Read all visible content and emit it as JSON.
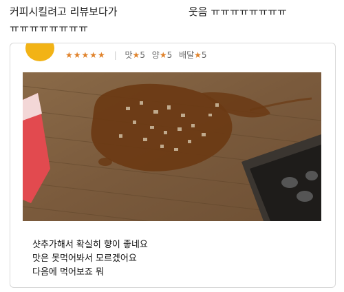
{
  "caption": {
    "line1_left": "커피시킬려고 리뷰보다가",
    "line1_right": "웃음 ㅠㅠㅠㅠㅠㅠㅠㅠ",
    "line2": "ㅠㅠㅠㅠㅠㅠㅠㅠ"
  },
  "review": {
    "stars": "★★★★★",
    "metrics": [
      {
        "label": "맛",
        "star": "★",
        "value": "5"
      },
      {
        "label": "양",
        "star": "★",
        "value": "5"
      },
      {
        "label": "배달",
        "star": "★",
        "value": "5"
      }
    ],
    "text_lines": [
      "샷추가해서 확실히 향이 좋네요",
      "맛은 못먹어봐서 모르겠어요",
      "다음에 먹어보죠 뭐"
    ]
  },
  "colors": {
    "star": "#e0822a",
    "avatar": "#f2b316"
  }
}
